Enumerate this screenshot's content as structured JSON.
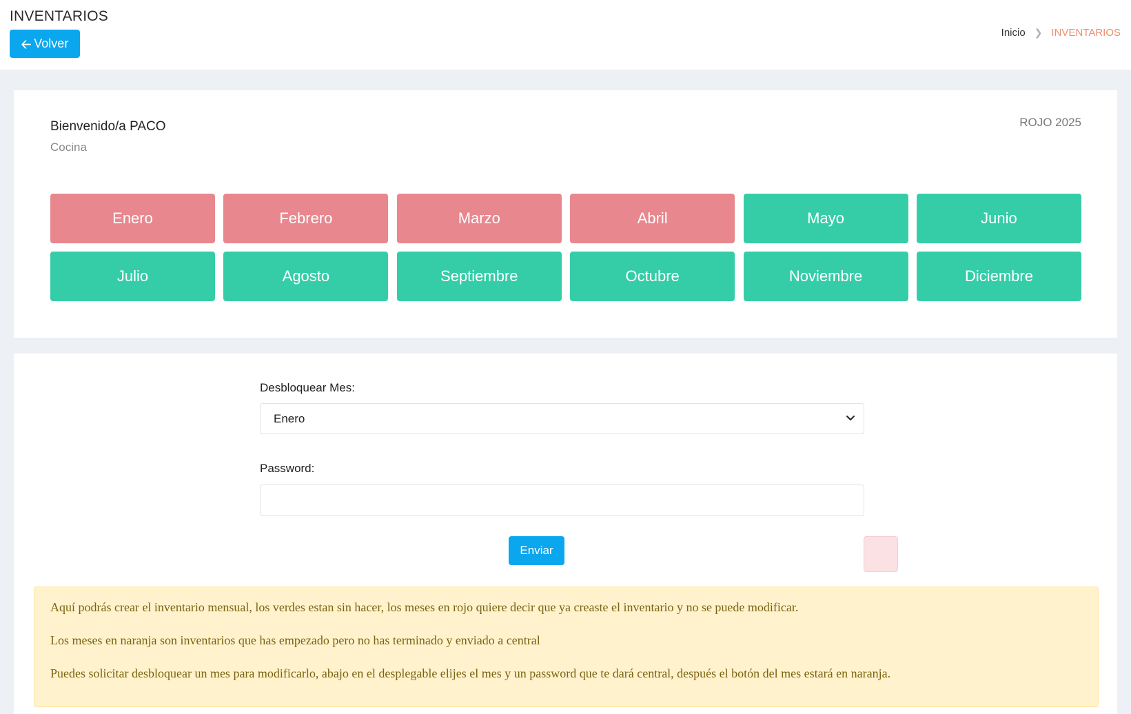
{
  "header": {
    "title": "INVENTARIOS",
    "back_label": "Volver",
    "breadcrumb": {
      "home": "Inicio",
      "current": "INVENTARIOS"
    }
  },
  "welcome": {
    "greeting": "Bienvenido/a PACO",
    "department": "Cocina",
    "year_label": "ROJO 2025"
  },
  "colors": {
    "done": "#e8878e",
    "pending": "#35cda8",
    "accent": "#0aa7ef",
    "breadcrumb_active": "#f08c6b"
  },
  "months": [
    {
      "label": "Enero",
      "status": "done"
    },
    {
      "label": "Febrero",
      "status": "done"
    },
    {
      "label": "Marzo",
      "status": "done"
    },
    {
      "label": "Abril",
      "status": "done"
    },
    {
      "label": "Mayo",
      "status": "pending"
    },
    {
      "label": "Junio",
      "status": "pending"
    },
    {
      "label": "Julio",
      "status": "pending"
    },
    {
      "label": "Agosto",
      "status": "pending"
    },
    {
      "label": "Septiembre",
      "status": "pending"
    },
    {
      "label": "Octubre",
      "status": "pending"
    },
    {
      "label": "Noviembre",
      "status": "pending"
    },
    {
      "label": "Diciembre",
      "status": "pending"
    }
  ],
  "unlock_form": {
    "month_label": "Desbloquear Mes:",
    "selected_month": "Enero",
    "password_label": "Password:",
    "password_value": "",
    "submit_label": "Enviar"
  },
  "notice": {
    "lines": [
      "Aquí podrás crear el inventario mensual, los verdes estan sin hacer, los meses en rojo quiere decir que ya creaste el inventario y no se puede modificar.",
      "Los meses en naranja son inventarios que has empezado pero no has terminado y enviado a central",
      "Puedes solicitar desbloquear un mes para modificarlo, abajo en el desplegable elijes el mes y un password que te dará central, después el botón del mes estará en naranja."
    ]
  }
}
